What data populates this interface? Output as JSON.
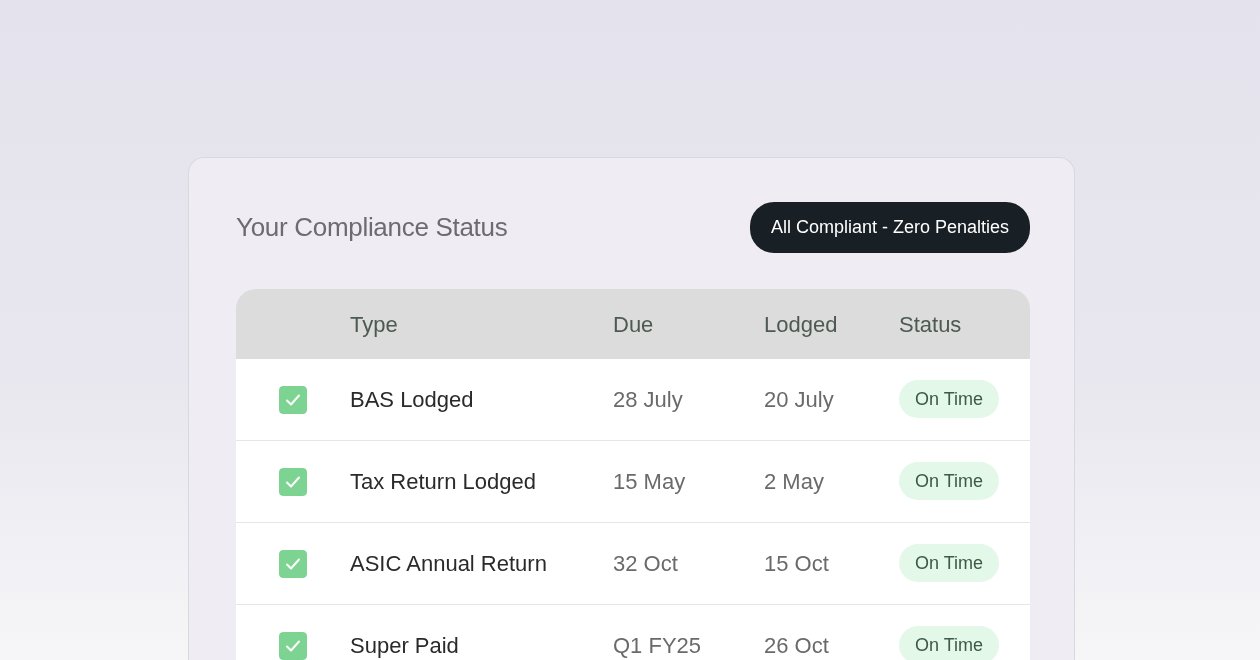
{
  "title": "Your Compliance Status",
  "badge": "All Compliant - Zero Penalties",
  "table": {
    "columns": [
      "Type",
      "Due",
      "Lodged",
      "Status"
    ],
    "rows": [
      {
        "checked": true,
        "type": "BAS Lodged",
        "due": "28 July",
        "lodged": "20 July",
        "status": "On Time"
      },
      {
        "checked": true,
        "type": "Tax Return Lodged",
        "due": "15 May",
        "lodged": "2 May",
        "status": "On Time"
      },
      {
        "checked": true,
        "type": "ASIC Annual Return",
        "due": "32 Oct",
        "lodged": "15 Oct",
        "status": "On Time"
      },
      {
        "checked": true,
        "type": "Super Paid",
        "due": "Q1 FY25",
        "lodged": "26 Oct",
        "status": "On Time"
      }
    ]
  }
}
